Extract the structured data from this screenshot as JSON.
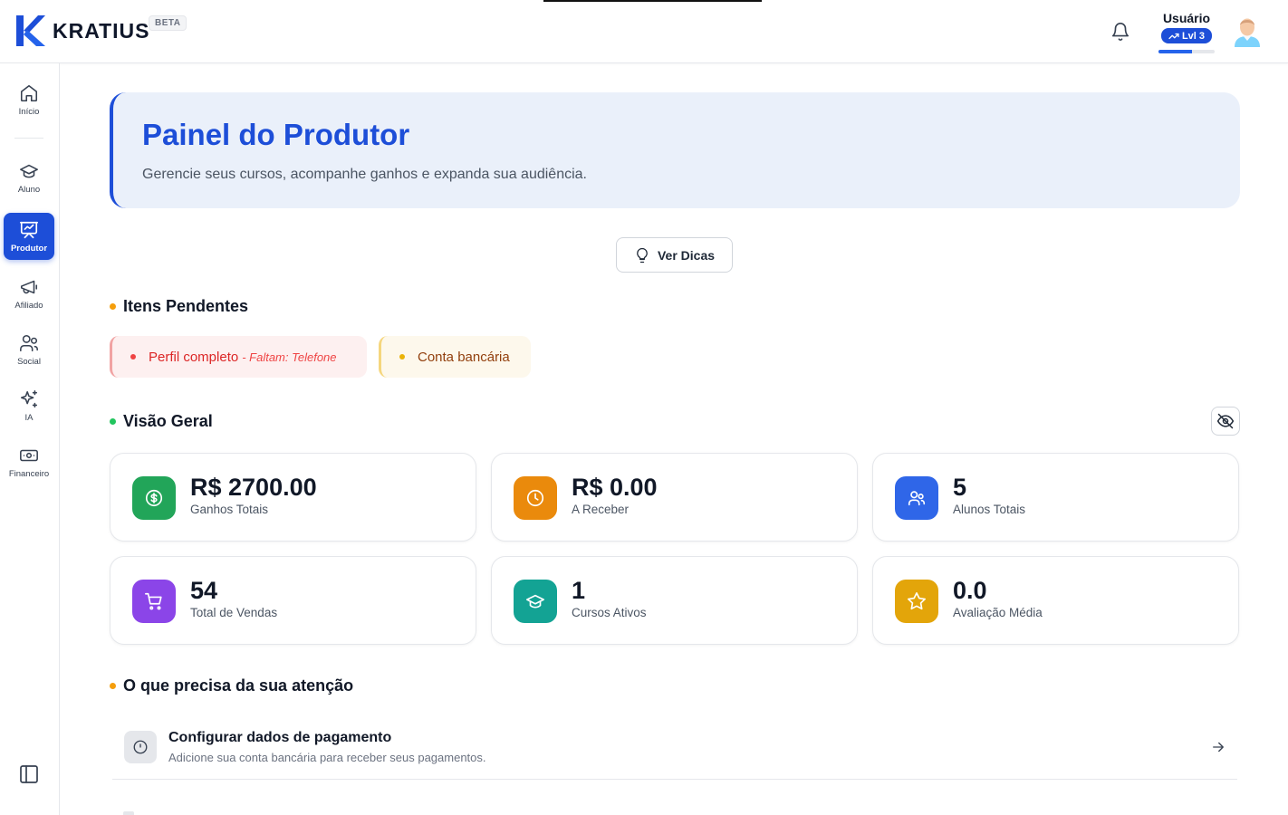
{
  "header": {
    "logo_text": "KRATIUS",
    "beta_label": "BETA",
    "user_name": "Usuário",
    "level_label": "Lvl 3",
    "level_progress": 0.6,
    "brand_color": "#1d4ed8",
    "icons": [
      "kratius-logo-icon",
      "bell-icon",
      "trending-up-icon",
      "avatar"
    ]
  },
  "sidebar": {
    "items": [
      {
        "label": "Início",
        "icon": "home-icon"
      },
      {
        "label": "Aluno",
        "icon": "graduation-cap-icon"
      },
      {
        "label": "Produtor",
        "icon": "presentation-chart-icon",
        "active": true
      },
      {
        "label": "Afiliado",
        "icon": "megaphone-icon"
      },
      {
        "label": "Social",
        "icon": "users-icon"
      },
      {
        "label": "IA",
        "icon": "sparkles-icon"
      },
      {
        "label": "Financeiro",
        "icon": "banknote-icon"
      }
    ],
    "collapse_icon": "panel-left-icon"
  },
  "hero": {
    "title": "Painel do Produtor",
    "subtitle": "Gerencie seus cursos, acompanhe ganhos e expanda sua audiência."
  },
  "tips_button": {
    "label": "Ver Dicas",
    "icon": "lightbulb-icon"
  },
  "pending": {
    "title": "Itens Pendentes",
    "items": [
      {
        "label": "Perfil completo",
        "detail": "- Faltam: Telefone",
        "status_color": "#ef4444"
      },
      {
        "label": "Conta bancária",
        "detail": "",
        "status_color": "#eab308"
      }
    ]
  },
  "overview": {
    "title": "Visão Geral",
    "toggle_icon": "eye-off-icon",
    "stats": [
      {
        "value": "R$ 2700.00",
        "label": "Ganhos Totais",
        "icon": "dollar-icon",
        "color": "#22a559"
      },
      {
        "value": "R$ 0.00",
        "label": "A Receber",
        "icon": "clock-icon",
        "color": "#ea8a0c"
      },
      {
        "value": "5",
        "label": "Alunos Totais",
        "icon": "users-icon",
        "color": "#2f66e8"
      },
      {
        "value": "54",
        "label": "Total de Vendas",
        "icon": "shopping-cart-icon",
        "color": "#8b45e8"
      },
      {
        "value": "1",
        "label": "Cursos Ativos",
        "icon": "graduation-cap-icon",
        "color": "#13a394"
      },
      {
        "value": "0.0",
        "label": "Avaliação Média",
        "icon": "star-icon",
        "color": "#e3a50a"
      }
    ]
  },
  "attention": {
    "title": "O que precisa da sua atenção",
    "items": [
      {
        "title": "Configurar dados de pagamento",
        "description": "Adicione sua conta bancária para receber seus pagamentos.",
        "icon": "clock-icon"
      }
    ]
  }
}
